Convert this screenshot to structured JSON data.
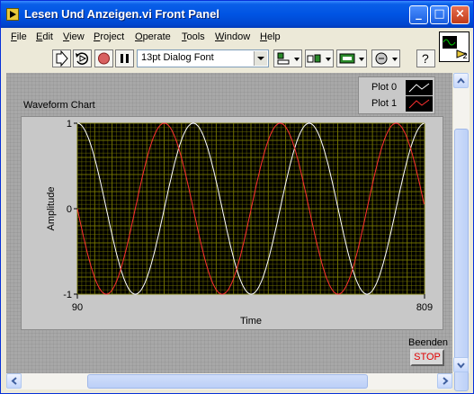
{
  "window": {
    "title": "Lesen Und Anzeigen.vi Front Panel",
    "buttons": {
      "minimize": "_",
      "maximize": "□",
      "close": "×"
    }
  },
  "menubar": {
    "items": [
      {
        "label": "File",
        "mnemonic": "F",
        "rest": "ile"
      },
      {
        "label": "Edit",
        "mnemonic": "E",
        "rest": "dit"
      },
      {
        "label": "View",
        "mnemonic": "V",
        "rest": "iew"
      },
      {
        "label": "Project",
        "mnemonic": "P",
        "rest": "roject"
      },
      {
        "label": "Operate",
        "mnemonic": "O",
        "rest": "perate"
      },
      {
        "label": "Tools",
        "mnemonic": "T",
        "rest": "ools"
      },
      {
        "label": "Window",
        "mnemonic": "W",
        "rest": "indow"
      },
      {
        "label": "Help",
        "mnemonic": "H",
        "rest": "elp"
      }
    ]
  },
  "toolbar": {
    "font_selector": "13pt Dialog Font",
    "icons": [
      "run-arrow-icon",
      "run-continuously-icon",
      "abort-icon",
      "pause-icon",
      "align-objects-icon",
      "distribute-objects-icon",
      "resize-objects-icon",
      "reorder-icon",
      "help-icon"
    ]
  },
  "vi_icon": {
    "label": "2"
  },
  "front_panel": {
    "chart_label": "Waveform Chart",
    "stop": {
      "label": "Beenden",
      "button_text": "STOP"
    }
  },
  "chart_data": {
    "type": "line",
    "title": "Waveform Chart",
    "xlabel": "Time",
    "ylabel": "Amplitude",
    "xlim": [
      90,
      809
    ],
    "ylim": [
      -1,
      1
    ],
    "x_ticks": [
      "90",
      "809"
    ],
    "y_ticks": [
      "1",
      "0",
      "-1"
    ],
    "grid": true,
    "legend_placement": "top-right",
    "series": [
      {
        "name": "Plot 0",
        "color": "#ffffff",
        "function": "cos",
        "period": 240,
        "phase_x": 90
      },
      {
        "name": "Plot 1",
        "color": "#ff3030",
        "function": "sin",
        "period": 240,
        "phase_x": 90,
        "sign": -1
      }
    ],
    "plot_background": "#000000",
    "grid_color": "#7a7a00"
  }
}
